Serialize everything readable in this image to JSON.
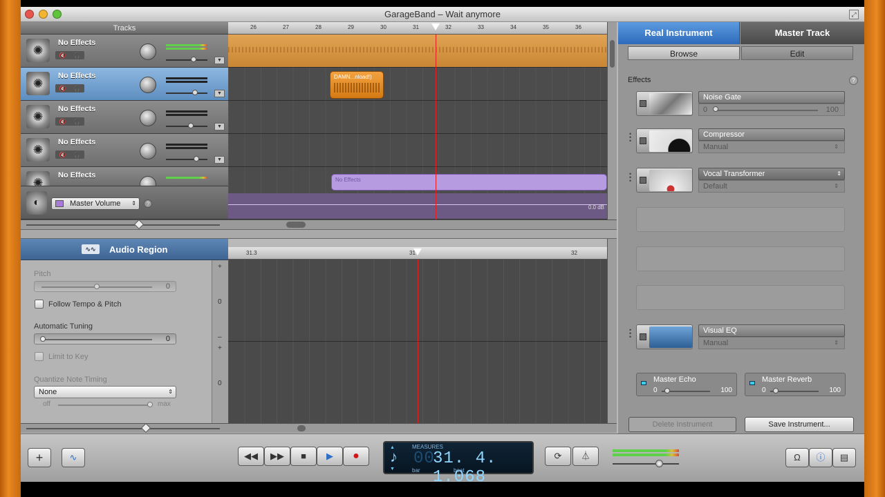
{
  "window": {
    "title": "GarageBand – Wait anymore"
  },
  "tracks_header": "Tracks",
  "tracks": [
    {
      "name": "No Effects"
    },
    {
      "name": "No Effects"
    },
    {
      "name": "No Effects"
    },
    {
      "name": "No Effects"
    },
    {
      "name": "No Effects"
    }
  ],
  "master": {
    "label": "Master Volume",
    "db": "0.0 dB"
  },
  "ruler": [
    "26",
    "27",
    "28",
    "29",
    "30",
    "31",
    "32",
    "33",
    "34",
    "35",
    "36"
  ],
  "regions": {
    "orange_label": "DAMN...nload!)",
    "purple_label": "No Effects"
  },
  "editor": {
    "title": "Audio Region",
    "pitch_label": "Pitch",
    "pitch_value": "0",
    "follow_label": "Follow Tempo & Pitch",
    "auto_tuning_label": "Automatic Tuning",
    "auto_tuning_value": "0",
    "limit_label": "Limit to Key",
    "quantize_label": "Quantize Note Timing",
    "quantize_value": "None",
    "quantize_off": "off",
    "quantize_max": "max",
    "ruler_a": "31.3",
    "ruler_b": "31",
    "ruler_c": "32",
    "vbar_plus": "+",
    "vbar_zero": "0",
    "vbar_minus": "–"
  },
  "right_panel": {
    "tab_instrument": "Real Instrument",
    "tab_master": "Master Track",
    "sub_browse": "Browse",
    "sub_edit": "Edit",
    "effects_label": "Effects",
    "effects": [
      {
        "name": "Noise Gate",
        "sub_lo": "0",
        "sub_hi": "100",
        "kind": "slider"
      },
      {
        "name": "Compressor",
        "sub": "Manual",
        "kind": "preset"
      },
      {
        "name": "Vocal Transformer",
        "sub": "Default",
        "kind": "preset"
      },
      {
        "name": "Visual EQ",
        "sub": "Manual",
        "kind": "preset"
      }
    ],
    "master_echo": {
      "name": "Master Echo",
      "lo": "0",
      "hi": "100"
    },
    "master_reverb": {
      "name": "Master Reverb",
      "lo": "0",
      "hi": "100"
    },
    "delete_btn": "Delete Instrument",
    "save_btn": "Save Instrument..."
  },
  "lcd": {
    "mode": "MEASURES",
    "value": "31. 4. 1.068",
    "lead": "00",
    "bar": "bar",
    "beat": "beat"
  },
  "colors": {
    "accent": "#3d7ec8",
    "record": "#d01818",
    "playhead": "#e32020"
  }
}
